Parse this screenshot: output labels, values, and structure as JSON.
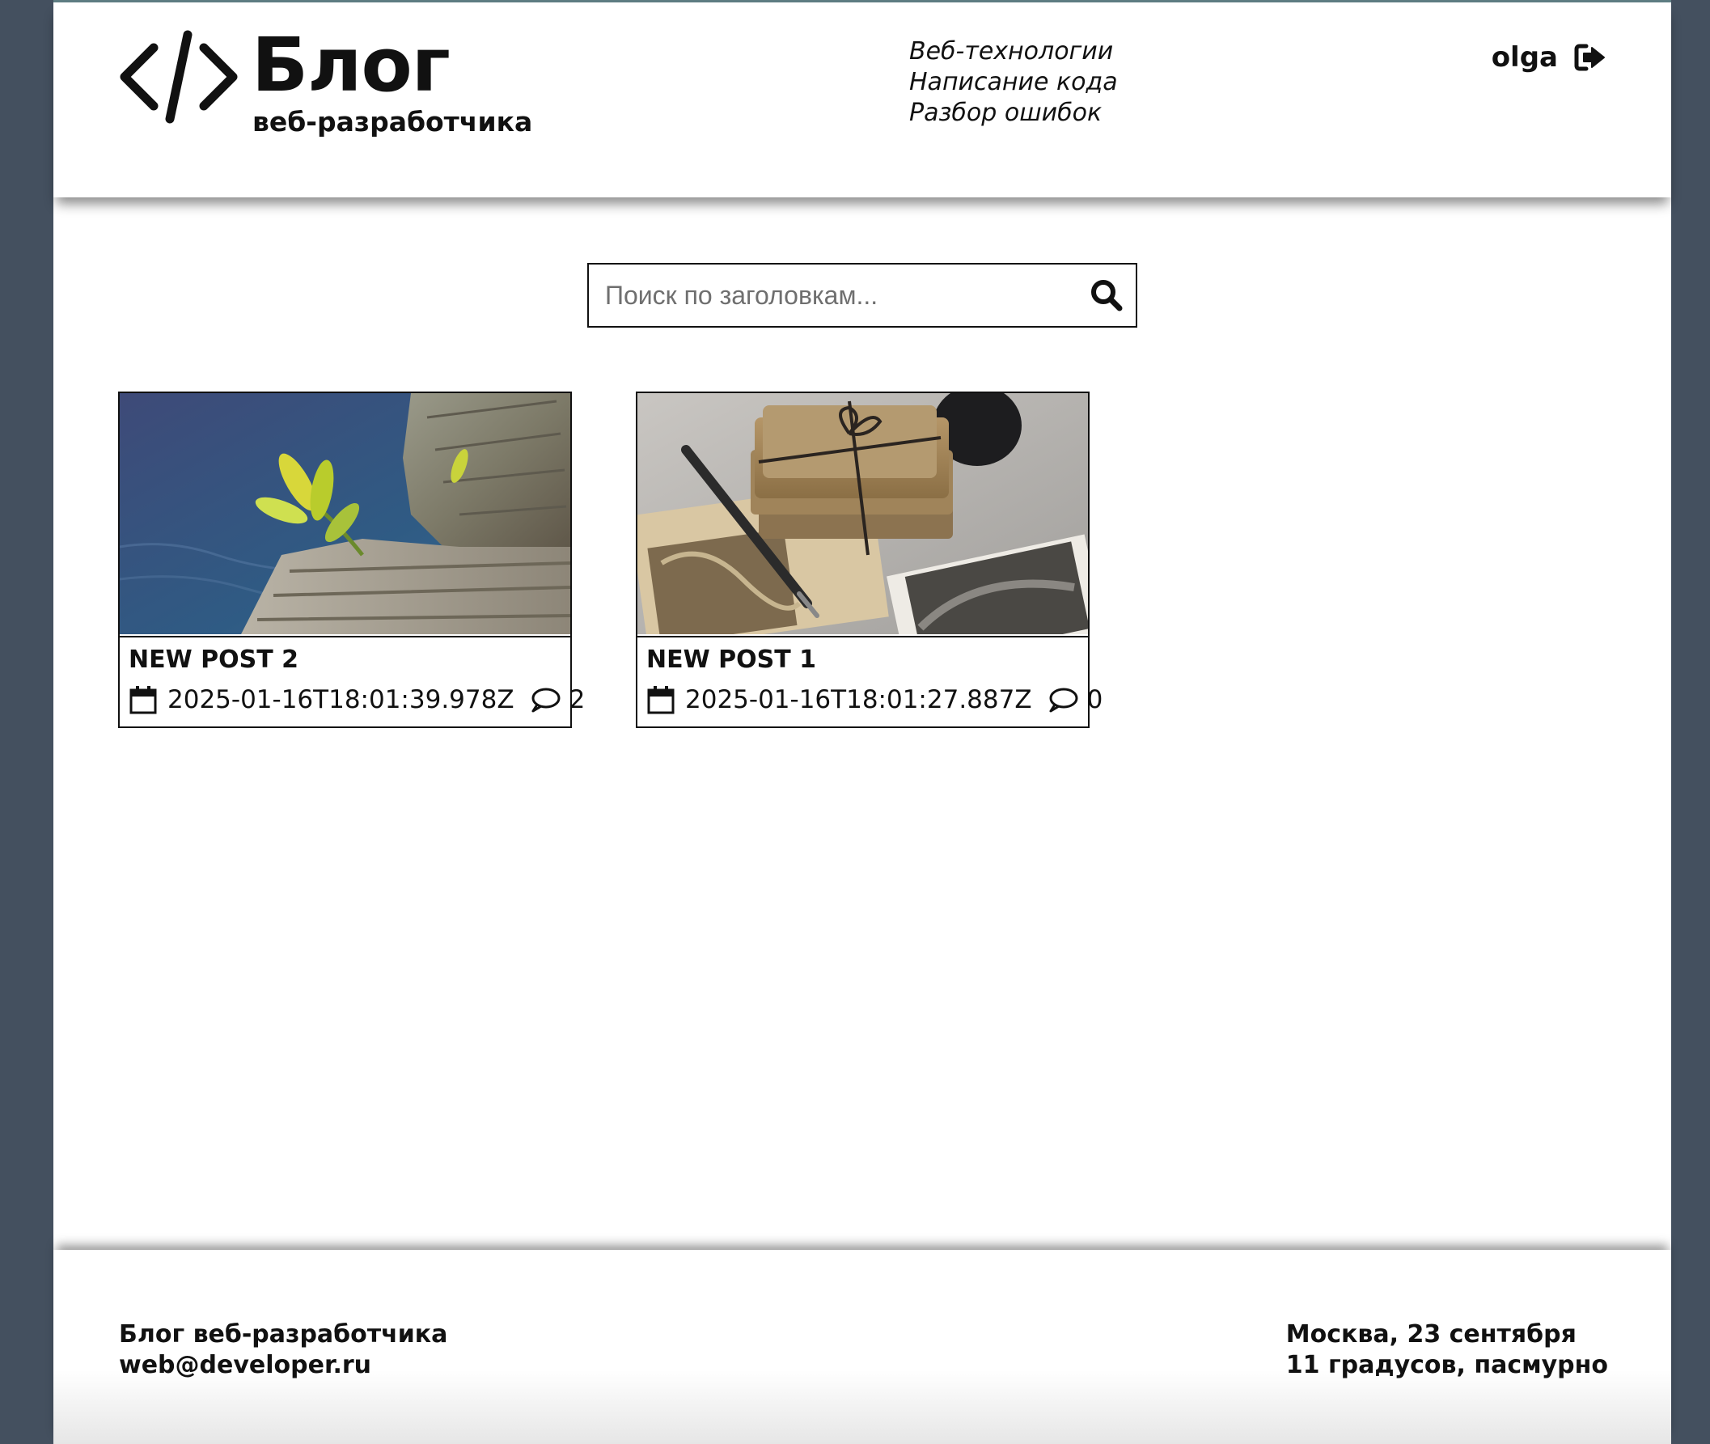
{
  "header": {
    "logo_title": "Блог",
    "logo_subtitle": "веб-разработчика",
    "nav": [
      "Веб-технологии",
      "Написание кода",
      "Разбор ошибок"
    ],
    "username": "olga"
  },
  "search": {
    "placeholder": "Поиск по заголовкам...",
    "value": ""
  },
  "posts": [
    {
      "title": "NEW POST 2",
      "date": "2025-01-16T18:01:39.978Z",
      "comments": "2",
      "image": "plant-sprout-on-tree-stump-by-water"
    },
    {
      "title": "NEW POST 1",
      "date": "2025-01-16T18:01:27.887Z",
      "comments": "0",
      "image": "old-letters-pen-and-photographs"
    }
  ],
  "footer": {
    "left_line1": "Блог веб-разработчика",
    "left_line2": "web@developer.ru",
    "right_line1": "Москва, 23 сентября",
    "right_line2": "11 градусов, пасмурно"
  },
  "colors": {
    "background": "#44505f",
    "page": "#ffffff",
    "text": "#111111",
    "accent_top_border": "#5e7d82"
  },
  "icons": [
    "code-logo-icon",
    "logout-icon",
    "search-icon",
    "calendar-icon",
    "comment-icon"
  ]
}
